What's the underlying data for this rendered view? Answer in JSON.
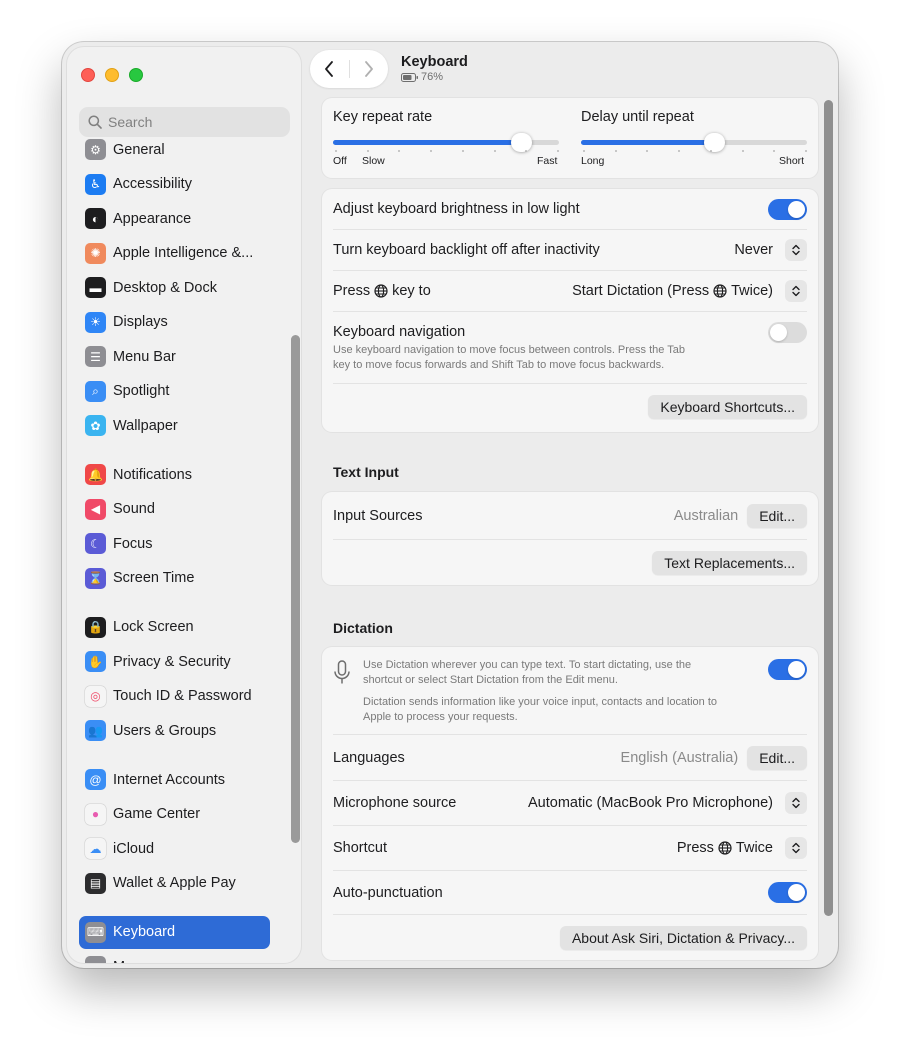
{
  "window": {
    "title": "Keyboard",
    "battery": "76%"
  },
  "sidebar": {
    "search_placeholder": "Search",
    "items": [
      {
        "label": "General",
        "icon": "gear-icon",
        "color": "#8e8e93"
      },
      {
        "label": "Accessibility",
        "icon": "accessibility-icon",
        "color": "#1c7cf2"
      },
      {
        "label": "Appearance",
        "icon": "appearance-icon",
        "color": "#1d1d1f"
      },
      {
        "label": "Apple Intelligence &...",
        "icon": "apple-intelligence-icon",
        "color": "#f08a5d"
      },
      {
        "label": "Desktop & Dock",
        "icon": "dock-icon",
        "color": "#1d1d1f"
      },
      {
        "label": "Displays",
        "icon": "sun-icon",
        "color": "#2f86f6"
      },
      {
        "label": "Menu Bar",
        "icon": "menu-bar-icon",
        "color": "#8e8e93"
      },
      {
        "label": "Spotlight",
        "icon": "magnifier-icon",
        "color": "#3a8ef5"
      },
      {
        "label": "Wallpaper",
        "icon": "flower-icon",
        "color": "#3ab4f0"
      },
      {
        "label": "Notifications",
        "icon": "bell-icon",
        "color": "#f04848"
      },
      {
        "label": "Sound",
        "icon": "speaker-icon",
        "color": "#f04a68"
      },
      {
        "label": "Focus",
        "icon": "moon-icon",
        "color": "#5b5bd6"
      },
      {
        "label": "Screen Time",
        "icon": "hourglass-icon",
        "color": "#5b5bd6"
      },
      {
        "label": "Lock Screen",
        "icon": "lock-icon",
        "color": "#1d1d1f"
      },
      {
        "label": "Privacy & Security",
        "icon": "hand-icon",
        "color": "#3a8ef5"
      },
      {
        "label": "Touch ID & Password",
        "icon": "fingerprint-icon",
        "color": "#f5f5f5"
      },
      {
        "label": "Users & Groups",
        "icon": "users-icon",
        "color": "#3a8ef5"
      },
      {
        "label": "Internet Accounts",
        "icon": "at-icon",
        "color": "#3a8ef5"
      },
      {
        "label": "Game Center",
        "icon": "game-center-icon",
        "color": "#f5f5f5"
      },
      {
        "label": "iCloud",
        "icon": "cloud-icon",
        "color": "#f5f5f5"
      },
      {
        "label": "Wallet & Apple Pay",
        "icon": "wallet-icon",
        "color": "#2c2c2e"
      },
      {
        "label": "Keyboard",
        "icon": "keyboard-icon",
        "color": "#8e8e93",
        "selected": true
      },
      {
        "label": "Mouse",
        "icon": "mouse-icon",
        "color": "#8e8e93"
      }
    ]
  },
  "key_repeat": {
    "label": "Key repeat rate",
    "left_caps": [
      "Off",
      "Slow"
    ],
    "right_cap": "Fast",
    "value": 0.83
  },
  "delay_repeat": {
    "label": "Delay until repeat",
    "left_cap": "Long",
    "right_cap": "Short",
    "value": 0.59
  },
  "keyboard": {
    "brightness_label": "Adjust keyboard brightness in low light",
    "brightness_on": true,
    "backlight_label": "Turn keyboard backlight off after inactivity",
    "backlight_value": "Never",
    "press_key_label_pre": "Press",
    "press_key_label_post": "key to",
    "press_key_value_pre": "Start Dictation (Press",
    "press_key_value_post": "Twice)",
    "nav_label": "Keyboard navigation",
    "nav_desc_1": "Use keyboard navigation to move focus between controls. Press the Tab",
    "nav_desc_2": "key to move focus forwards and Shift Tab to move focus backwards.",
    "nav_on": false,
    "shortcuts_button": "Keyboard Shortcuts..."
  },
  "text_input": {
    "heading": "Text Input",
    "sources_label": "Input Sources",
    "sources_value": "Australian",
    "edit_button": "Edit...",
    "replacements_button": "Text Replacements..."
  },
  "dictation": {
    "heading": "Dictation",
    "desc_1": "Use Dictation wherever you can type text. To start dictating, use the",
    "desc_2": "shortcut or select Start Dictation from the Edit menu.",
    "desc_3": "Dictation sends information like your voice input, contacts and location to",
    "desc_4": "Apple to process your requests.",
    "enabled": true,
    "languages_label": "Languages",
    "languages_value": "English (Australia)",
    "languages_edit": "Edit...",
    "mic_label": "Microphone source",
    "mic_value": "Automatic (MacBook Pro Microphone)",
    "shortcut_label": "Shortcut",
    "shortcut_value_pre": "Press",
    "shortcut_value_post": "Twice",
    "autopunct_label": "Auto-punctuation",
    "autopunct_on": true,
    "about_button": "About Ask Siri, Dictation & Privacy..."
  },
  "colors": {
    "accent": "#2a6fe5",
    "selection": "#2e6bd6"
  }
}
